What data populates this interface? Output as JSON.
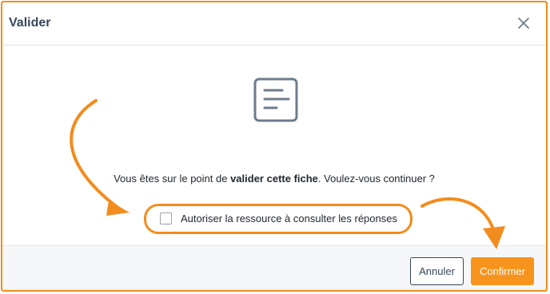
{
  "dialog": {
    "title": "Valider",
    "close_icon": "close-icon",
    "doc_icon": "document-list-icon"
  },
  "body": {
    "message_prefix": "Vous êtes sur le point de ",
    "message_bold": "valider cette fiche",
    "message_suffix": ". Voulez-vous continuer ?",
    "checkbox_label": "Autoriser la ressource à consulter les réponses",
    "checkbox_checked": false
  },
  "footer": {
    "cancel_label": "Annuler",
    "confirm_label": "Confirmer"
  },
  "colors": {
    "accent": "#f7941d",
    "annotation": "#f28c1e",
    "title": "#37475a"
  }
}
